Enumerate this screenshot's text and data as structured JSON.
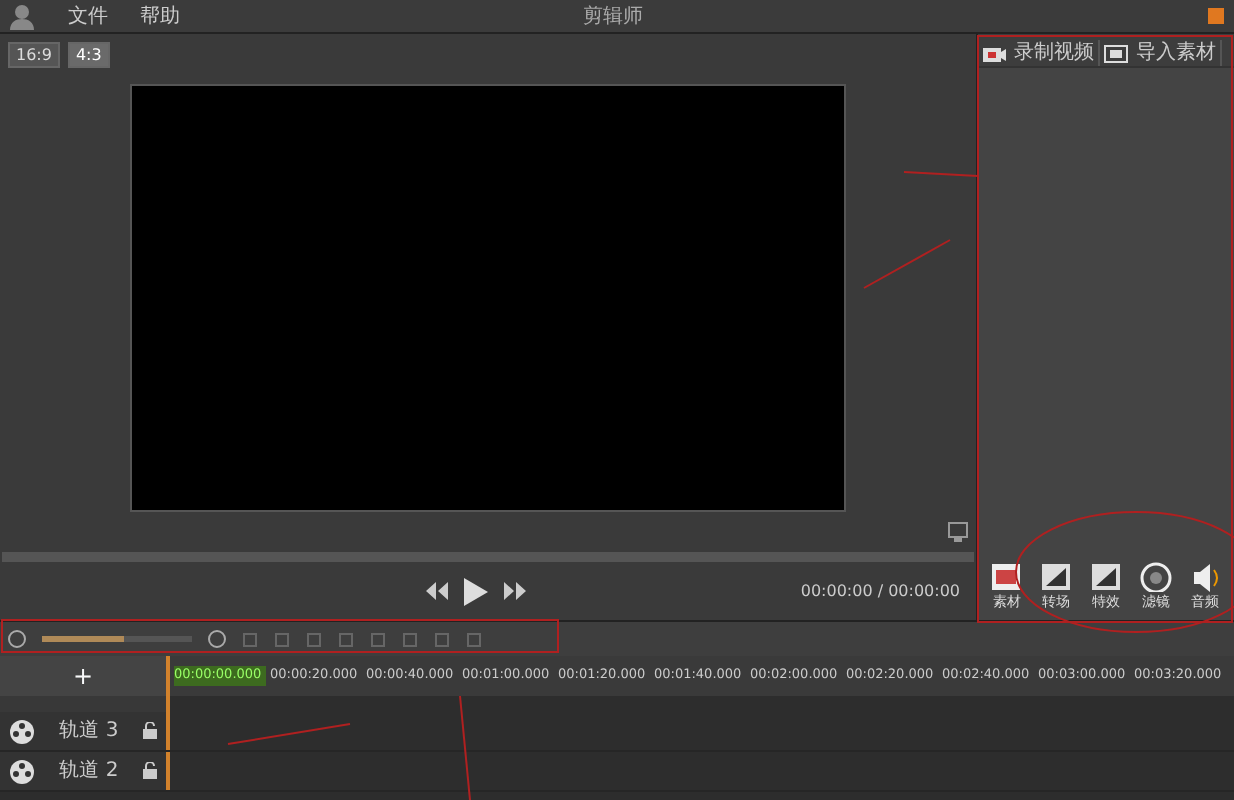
{
  "menu": [
    "文件",
    "帮助"
  ],
  "window": {
    "title": "剪辑师"
  },
  "preview": {
    "ratio_buttons": [
      {
        "label": "16:9",
        "selected": false
      },
      {
        "label": "4:3",
        "selected": true
      }
    ],
    "time": "00:00:00 / 00:00:00"
  },
  "side_tabs": [
    {
      "label": "录制视频",
      "kind": "camera"
    },
    {
      "label": "导入素材",
      "kind": "folder"
    }
  ],
  "tools": [
    {
      "label": "素材",
      "kind": "photo"
    },
    {
      "label": "转场",
      "kind": "frame"
    },
    {
      "label": "特效",
      "kind": "frame"
    },
    {
      "label": "滤镜",
      "kind": "circle"
    },
    {
      "label": "音频",
      "kind": "speaker"
    }
  ],
  "zoom": {
    "level": 0.55
  },
  "ruler": [
    "00:00:00.000",
    "00:00:20.000",
    "00:00:40.000",
    "00:01:00.000",
    "00:01:20.000",
    "00:01:40.000",
    "00:02:00.000",
    "00:02:20.000",
    "00:02:40.000",
    "00:03:00.000",
    "00:03:20.000"
  ],
  "add_track": "+",
  "tracks": [
    {
      "name": "轨道 3"
    },
    {
      "name": "轨道 2"
    }
  ]
}
